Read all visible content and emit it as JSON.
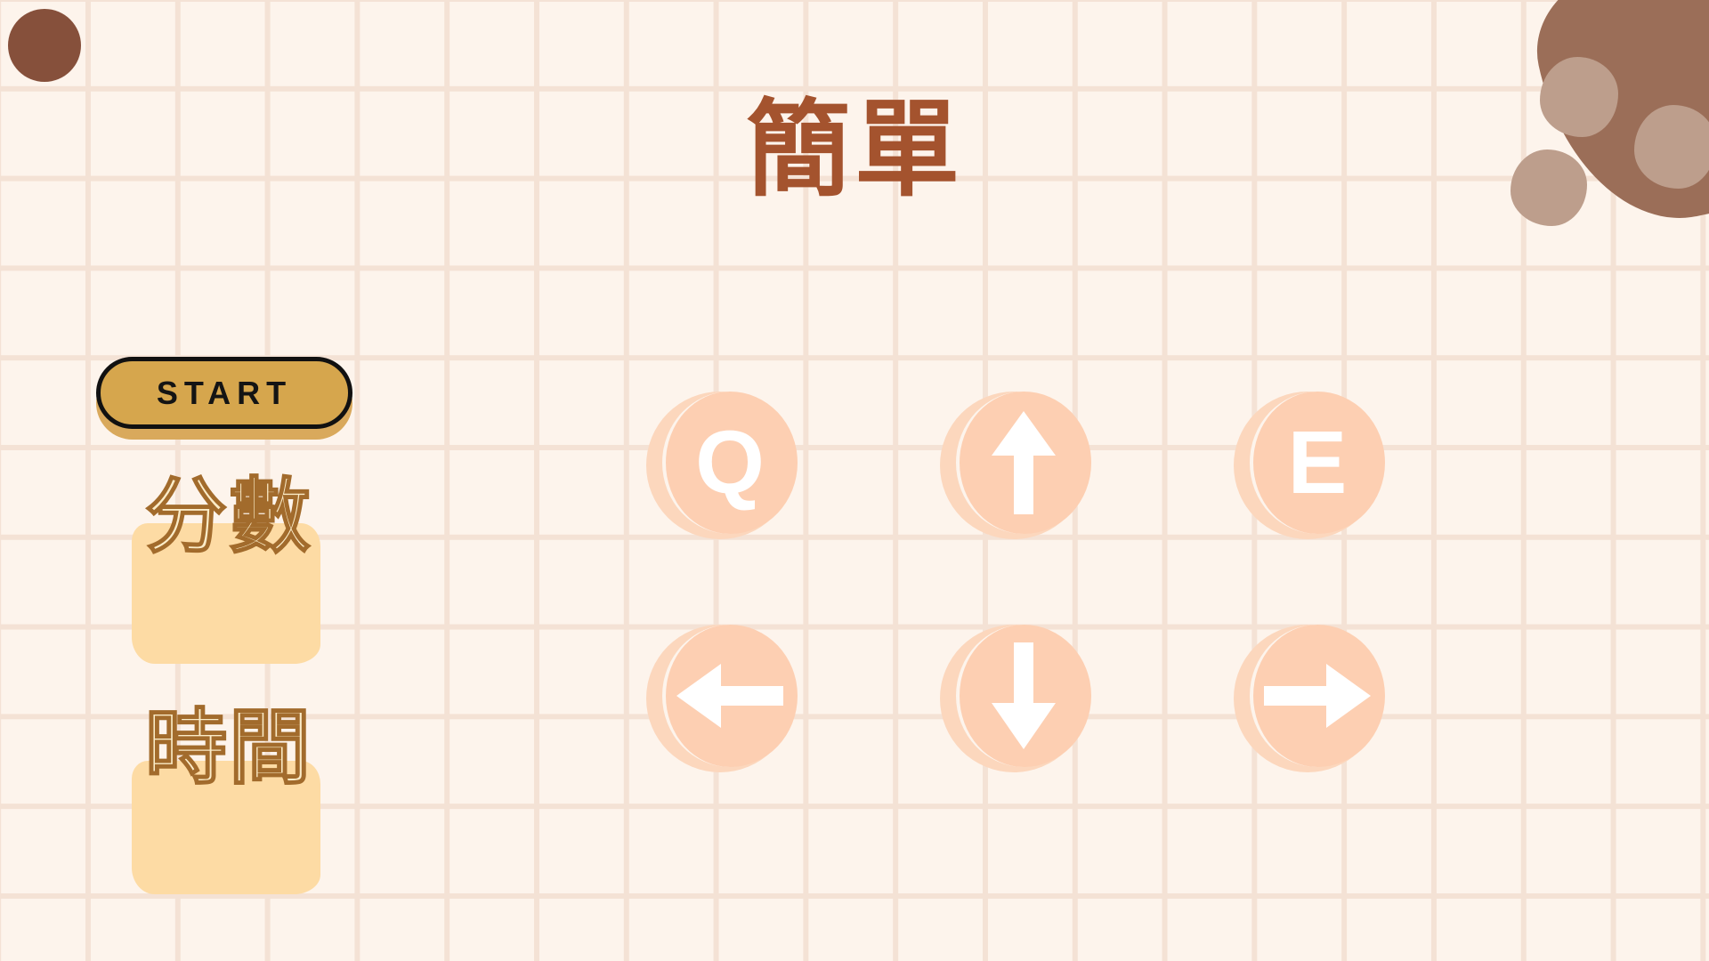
{
  "title": "簡單",
  "start_button": {
    "label": "START"
  },
  "stats": {
    "score_label": "分數",
    "score_value": "",
    "time_label": "時間",
    "time_value": ""
  },
  "keys": {
    "q": "Q",
    "e": "E",
    "up_icon": "arrow-up-icon",
    "down_icon": "arrow-down-icon",
    "left_icon": "arrow-left-icon",
    "right_icon": "arrow-right-icon"
  },
  "colors": {
    "background": "#fdf4ec",
    "grid": "#f4e2d5",
    "title": "#a4532e",
    "start_button": "#d6a64d",
    "key_face": "#fdcfb2",
    "stat_panel": "#fddba4",
    "corner_dot": "#86503b",
    "corner_blob": "#9b6e58"
  }
}
